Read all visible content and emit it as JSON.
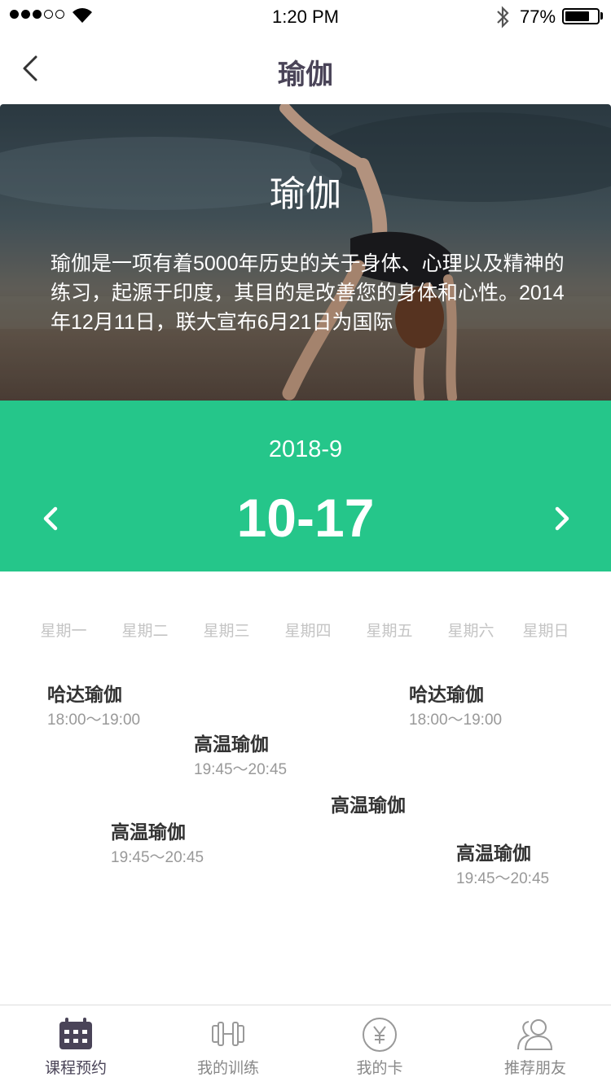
{
  "status_bar": {
    "time": "1:20 PM",
    "battery": "77%",
    "battery_level": 0.77,
    "signal_bars_filled": 3,
    "signal_bars_total": 5
  },
  "nav": {
    "title": "瑜伽",
    "back_icon": "chevron-left-icon"
  },
  "hero": {
    "title": "瑜伽",
    "description": "瑜伽是一项有着5000年历史的关于身体、心理以及精神的练习，起源于印度，其目的是改善您的身体和心性。2014年12月11日，联大宣布6月21日为国际"
  },
  "week_selector": {
    "month": "2018-9",
    "range": "10-17",
    "prev_icon": "chevron-left-icon",
    "next_icon": "chevron-right-icon"
  },
  "weekdays": [
    "星期一",
    "星期二",
    "星期三",
    "星期四",
    "星期五",
    "星期六",
    "星期日"
  ],
  "classes": [
    {
      "name": "哈达瑜伽",
      "time": "18:00～19:00"
    },
    {
      "name": "高温瑜伽",
      "time": "19:45～20:45"
    },
    {
      "name": "高温瑜伽",
      "time": "19:45～20:45"
    },
    {
      "name": "高温瑜伽",
      "time": ""
    },
    {
      "name": "哈达瑜伽",
      "time": "18:00～19:00"
    },
    {
      "name": "高温瑜伽",
      "time": "19:45～20:45"
    }
  ],
  "tabs": [
    {
      "label": "课程预约",
      "icon": "calendar-icon",
      "active": true
    },
    {
      "label": "我的训练",
      "icon": "dumbbell-icon",
      "active": false
    },
    {
      "label": "我的卡",
      "icon": "yuan-icon",
      "active": false
    },
    {
      "label": "推荐朋友",
      "icon": "friends-icon",
      "active": false
    }
  ],
  "colors": {
    "accent_green": "#25c68a",
    "title_purple": "#4a4458",
    "weekday_gray": "#c4c4c4"
  }
}
